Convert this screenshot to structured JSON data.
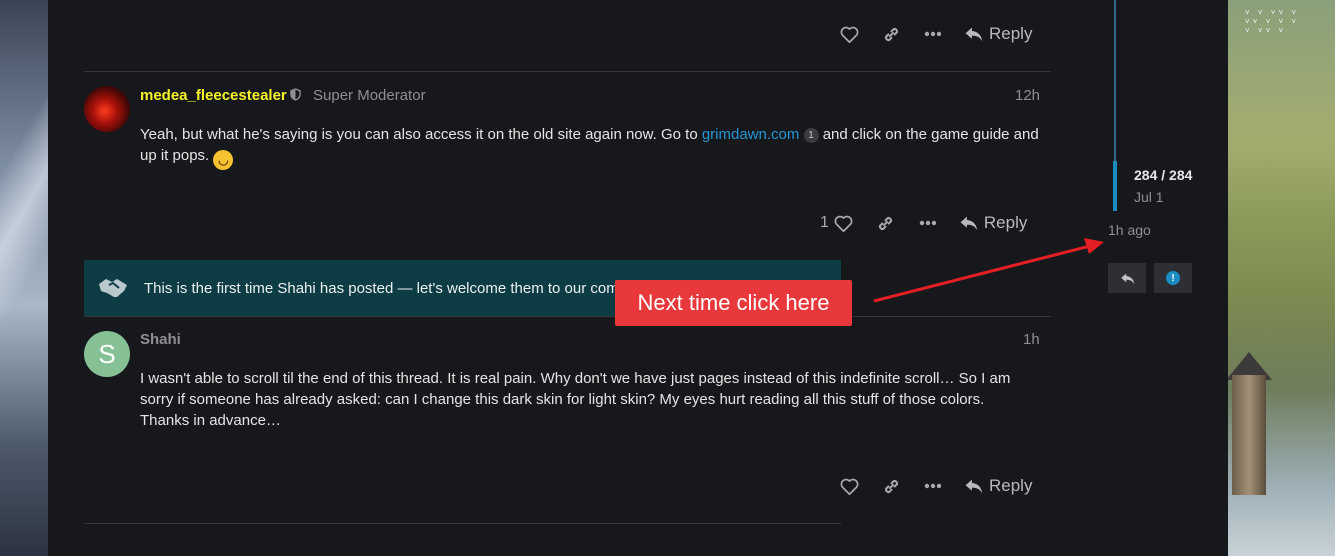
{
  "post_actions": {
    "reply_label": "Reply",
    "like_count_post1": "1"
  },
  "post1": {
    "username": "medea_fleecestealer",
    "user_title": "Super Moderator",
    "date": "12h",
    "text_before_link": "Yeah, but what he's saying is you can also access it on the old site again now. Go to",
    "link_text": "grimdawn.com",
    "link_click_count": "1",
    "text_after_link": "and click on the game guide and",
    "text_line2": "up it pops."
  },
  "welcome_notice": {
    "text": "This is the first time Shahi has posted — let's welcome them to our com"
  },
  "post2": {
    "avatar_letter": "S",
    "username": "Shahi",
    "date": "1h",
    "line1": "I wasn't able to scroll til the end of this thread. It is real pain. Why don't we have just pages instead of this indefinite scroll… So I am",
    "line2": "sorry if someone has already asked: can I change this dark skin for light skin? My eyes hurt reading all this stuff of those colors.",
    "line3": "Thanks in advance…"
  },
  "callout": {
    "text": "Next time click here"
  },
  "timeline": {
    "position": "284 / 284",
    "date": "Jul 1",
    "last_activity": "1h ago"
  },
  "colors": {
    "background": "#17181c",
    "accent_link": "#2596d6",
    "username_post1": "#f6f32a",
    "username_post2": "#8e8f93",
    "welcome_bg": "#0d3c45",
    "callout_bg": "#e8383b",
    "arrow": "#e41f23"
  },
  "icons": [
    "heart-icon",
    "link-icon",
    "ellipsis-icon",
    "reply-icon",
    "shield-icon",
    "handshake-icon",
    "info-icon"
  ]
}
